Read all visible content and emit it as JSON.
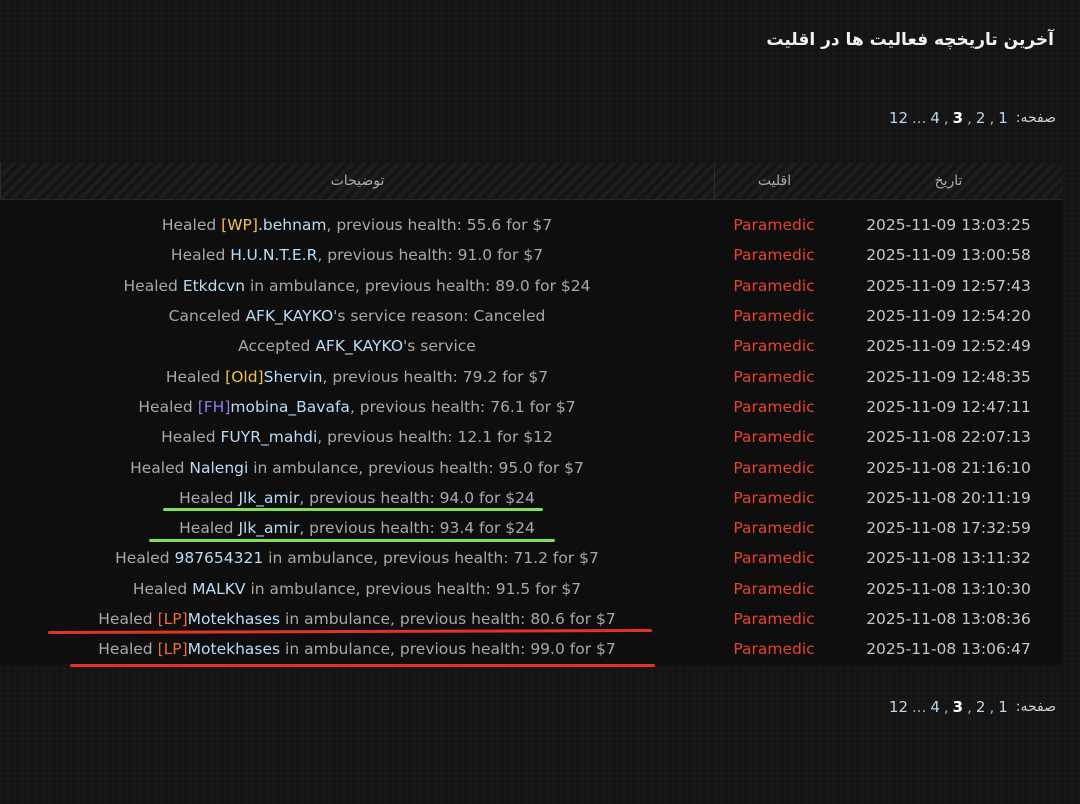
{
  "page": {
    "title": "آخرین تاریخچه فعالیت ها در اقلیت"
  },
  "pagination": {
    "label": "صفحه:",
    "pages": [
      "1",
      "2",
      "3",
      "4",
      "...",
      "12"
    ],
    "current": "3"
  },
  "table": {
    "columns": {
      "date": "تاریخ",
      "faction": "اقلیت",
      "description": "توضیحات"
    },
    "rows": [
      {
        "date": "2025-11-09 13:03:25",
        "faction": "Paramedic",
        "pre": "Healed ",
        "tag": "[WP]",
        "tag_color": "#f2c14b",
        "name": ".behnam",
        "post": ", previous health: 55.6 for $7"
      },
      {
        "date": "2025-11-09 13:00:58",
        "faction": "Paramedic",
        "pre": "Healed ",
        "tag": "",
        "tag_color": "",
        "name": "H.U.N.T.E.R",
        "post": ", previous health: 91.0 for $7"
      },
      {
        "date": "2025-11-09 12:57:43",
        "faction": "Paramedic",
        "pre": "Healed ",
        "tag": "",
        "tag_color": "",
        "name": "Etkdcvn",
        "post": " in ambulance, previous health: 89.0 for $24"
      },
      {
        "date": "2025-11-09 12:54:20",
        "faction": "Paramedic",
        "pre": "Canceled ",
        "tag": "",
        "tag_color": "",
        "name": "AFK_KAYKO",
        "post": "'s service reason: Canceled"
      },
      {
        "date": "2025-11-09 12:52:49",
        "faction": "Paramedic",
        "pre": "Accepted ",
        "tag": "",
        "tag_color": "",
        "name": "AFK_KAYKO",
        "post": "'s service"
      },
      {
        "date": "2025-11-09 12:48:35",
        "faction": "Paramedic",
        "pre": "Healed ",
        "tag": "[Old]",
        "tag_color": "#f2c14b",
        "name": "Shervin",
        "post": ", previous health: 79.2 for $7"
      },
      {
        "date": "2025-11-09 12:47:11",
        "faction": "Paramedic",
        "pre": "Healed ",
        "tag": "[FH]",
        "tag_color": "#8f7cf0",
        "name": "mobina_Bavafa",
        "post": ", previous health: 76.1 for $7"
      },
      {
        "date": "2025-11-08 22:07:13",
        "faction": "Paramedic",
        "pre": "Healed ",
        "tag": "",
        "tag_color": "",
        "name": "FUYR_mahdi",
        "post": ", previous health: 12.1 for $12"
      },
      {
        "date": "2025-11-08 21:16:10",
        "faction": "Paramedic",
        "pre": "Healed ",
        "tag": "",
        "tag_color": "",
        "name": "Nalengi",
        "post": " in ambulance, previous health: 95.0 for $7"
      },
      {
        "date": "2025-11-08 20:11:19",
        "faction": "Paramedic",
        "pre": "Healed ",
        "tag": "",
        "tag_color": "",
        "name": "Jlk_amir",
        "post": ", previous health: 94.0 for $24"
      },
      {
        "date": "2025-11-08 17:32:59",
        "faction": "Paramedic",
        "pre": "Healed ",
        "tag": "",
        "tag_color": "",
        "name": "Jlk_amir",
        "post": ", previous health: 93.4 for $24"
      },
      {
        "date": "2025-11-08 13:11:32",
        "faction": "Paramedic",
        "pre": "Healed ",
        "tag": "",
        "tag_color": "",
        "name": "987654321",
        "post": " in ambulance, previous health: 71.2 for $7"
      },
      {
        "date": "2025-11-08 13:10:30",
        "faction": "Paramedic",
        "pre": "Healed ",
        "tag": "",
        "tag_color": "",
        "name": "MALKV",
        "post": " in ambulance, previous health: 91.5 for $7"
      },
      {
        "date": "2025-11-08 13:08:36",
        "faction": "Paramedic",
        "pre": "Healed ",
        "tag": "[LP]",
        "tag_color": "#f26b36",
        "name": "Motekhases",
        "post": " in ambulance, previous health: 80.6 for $7"
      },
      {
        "date": "2025-11-08 13:06:47",
        "faction": "Paramedic",
        "pre": "Healed ",
        "tag": "[LP]",
        "tag_color": "#f26b36",
        "name": "Motekhases",
        "post": " in ambulance, previous health: 99.0 for $7"
      }
    ]
  },
  "annotations": {
    "green": "#7ee05a",
    "red": "#e43324"
  }
}
